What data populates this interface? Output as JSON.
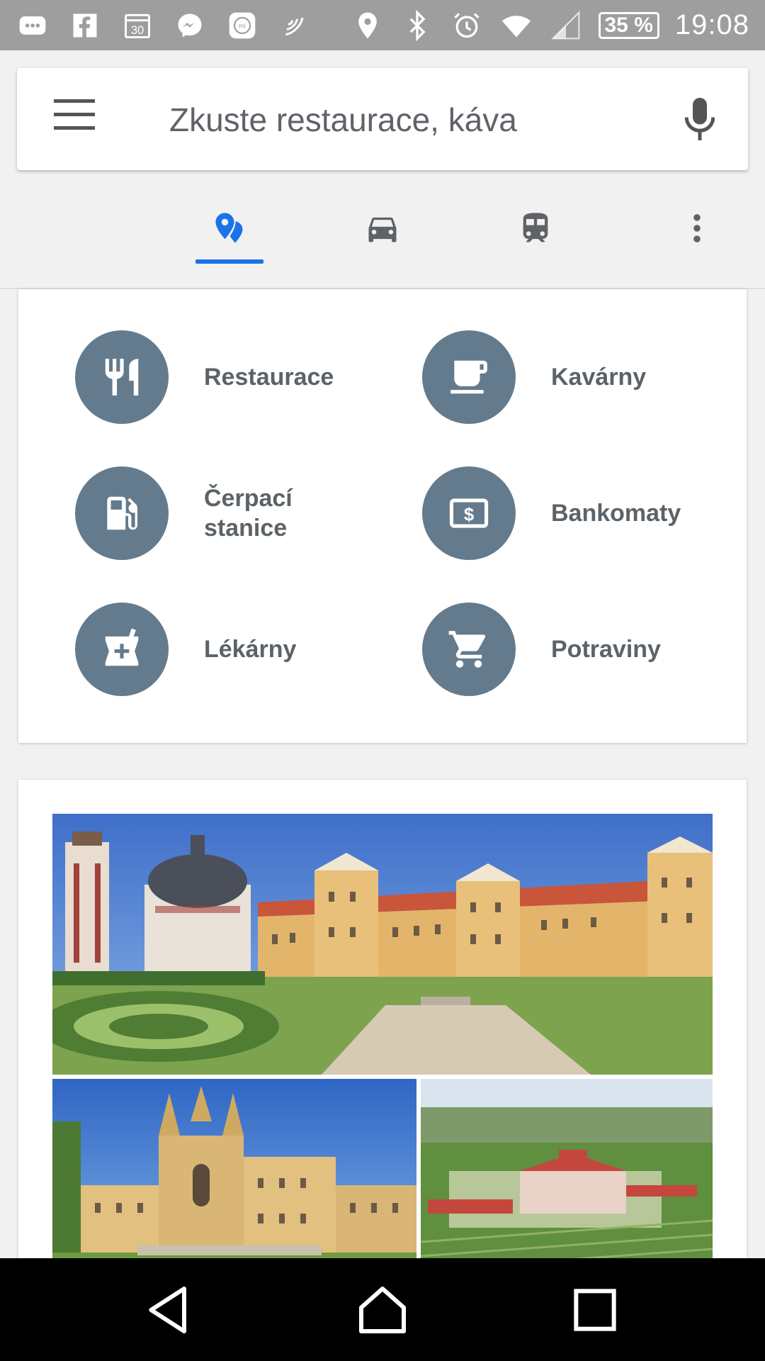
{
  "status_bar": {
    "left_icons": [
      "chat-bubble-icon",
      "facebook-icon",
      "calendar-icon",
      "messenger-icon",
      "mi-icon",
      "nfc-icon"
    ],
    "calendar_day": "30",
    "mi_label": "mi",
    "right_icons": [
      "location-icon",
      "bluetooth-icon",
      "alarm-icon",
      "wifi-icon",
      "signal-icon"
    ],
    "battery": "35 %",
    "time": "19:08"
  },
  "search": {
    "placeholder": "Zkuste restaurace, káva",
    "menu_icon": "hamburger-menu-icon",
    "mic_icon": "microphone-icon"
  },
  "tabs": [
    {
      "icon": "explore-places-icon",
      "active": true
    },
    {
      "icon": "car-icon",
      "active": false
    },
    {
      "icon": "transit-icon",
      "active": false
    },
    {
      "icon": "more-vertical-icon",
      "active": false
    }
  ],
  "accent_color": "#1a73e8",
  "category_color": "#647b8d",
  "categories": [
    {
      "label": "Restaurace",
      "icon": "restaurant-icon"
    },
    {
      "label": "Kavárny",
      "icon": "cafe-icon"
    },
    {
      "label": "Čerpací\nstanice",
      "label_line1": "Čerpací",
      "label_line2": "stanice",
      "icon": "gas-station-icon"
    },
    {
      "label": "Bankomaty",
      "icon": "atm-icon"
    },
    {
      "label": "Lékárny",
      "icon": "pharmacy-icon"
    },
    {
      "label": "Potraviny",
      "icon": "grocery-cart-icon"
    }
  ],
  "photos": [
    "castle-photo-large",
    "castle-photo-left",
    "palace-photo-right"
  ],
  "nav": {
    "back_icon": "back-triangle-icon",
    "home_icon": "home-icon",
    "recents_icon": "recents-square-icon"
  }
}
